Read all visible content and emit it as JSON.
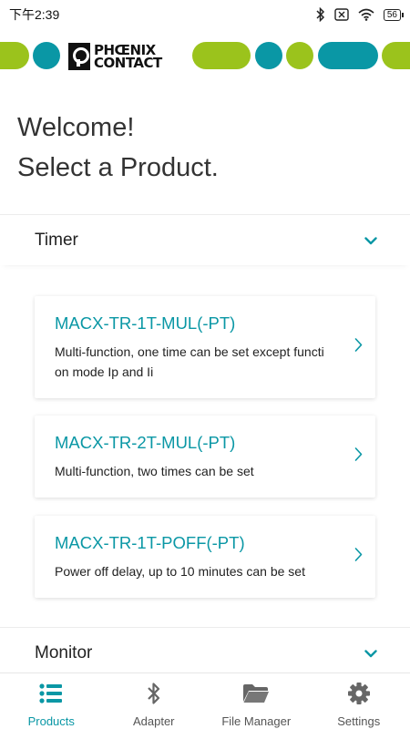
{
  "status_bar": {
    "time": "下午2:39",
    "battery": "56"
  },
  "colors": {
    "accent": "#0a97a5",
    "brand_green": "#9bc31c",
    "brand_teal": "#0a97a5"
  },
  "brand": {
    "line1": "PHŒNIX",
    "line2": "CONTACT"
  },
  "welcome": {
    "line1": "Welcome!",
    "line2": "Select a Product."
  },
  "sections": [
    {
      "title": "Timer",
      "icon": "chevron-down-icon"
    },
    {
      "title": "Monitor",
      "icon": "chevron-down-icon"
    }
  ],
  "products": [
    {
      "name": "MACX-TR-1T-MUL(-PT)",
      "description": "Multi-function, one time can be set except functi on mode Ip and Ii"
    },
    {
      "name": "MACX-TR-2T-MUL(-PT)",
      "description": "Multi-function, two times can be set"
    },
    {
      "name": "MACX-TR-1T-POFF(-PT)",
      "description": "Power off delay, up to 10 minutes can be set"
    }
  ],
  "nav": [
    {
      "label": "Products",
      "icon": "list-icon",
      "active": true
    },
    {
      "label": "Adapter",
      "icon": "bluetooth-icon",
      "active": false
    },
    {
      "label": "File Manager",
      "icon": "folder-icon",
      "active": false
    },
    {
      "label": "Settings",
      "icon": "gear-icon",
      "active": false
    }
  ]
}
